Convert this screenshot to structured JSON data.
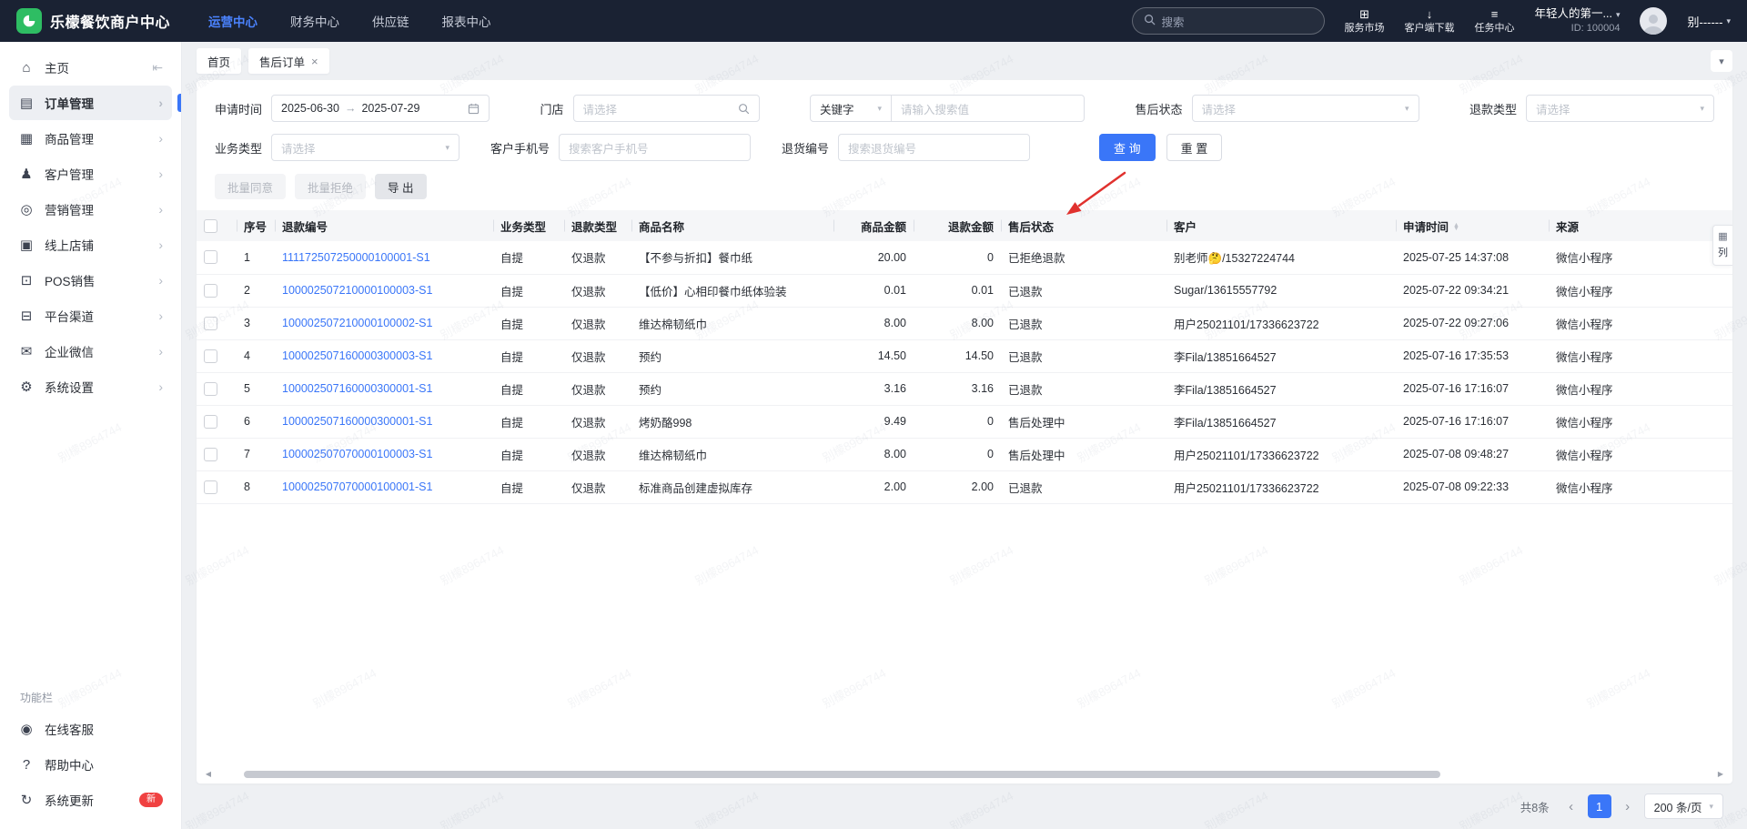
{
  "watermark": "别檬8964744",
  "icons": {
    "caret_down": "▾",
    "chevron_down": "▾",
    "close": "×",
    "prev": "‹",
    "next": "›",
    "sort_asc": "▲",
    "sort_desc": "▼",
    "scroll_left": "◀",
    "scroll_right": "▶",
    "grid": "▦"
  },
  "header": {
    "brand": "乐檬餐饮商户中心",
    "nav": [
      {
        "label": "运营中心",
        "name": "nav-operations-center",
        "active": true
      },
      {
        "label": "财务中心",
        "name": "nav-finance-center"
      },
      {
        "label": "供应链",
        "name": "nav-supply-chain"
      },
      {
        "label": "报表中心",
        "name": "nav-report-center"
      }
    ],
    "search_placeholder": "搜索",
    "quick_links": [
      {
        "label": "服务市场",
        "icon": "service-market-icon",
        "glyph": "⊞"
      },
      {
        "label": "客户端下载",
        "icon": "client-download-icon",
        "glyph": "↓"
      },
      {
        "label": "任务中心",
        "icon": "task-center-icon",
        "glyph": "≡"
      }
    ],
    "user": {
      "name": "年轻人的第一...",
      "id_label": "ID: 100004",
      "account": "别------"
    }
  },
  "sidebar": {
    "items": [
      {
        "label": "主页",
        "name": "sidebar-item-home",
        "icon": "home-icon",
        "glyph": "⌂",
        "arrow": "⇤",
        "arrow_icon": "collapse-sidebar-icon"
      },
      {
        "label": "订单管理",
        "name": "sidebar-item-orders",
        "icon": "order-icon",
        "glyph": "▤",
        "arrow": "›",
        "arrow_icon": "chevron-right-icon",
        "active": true
      },
      {
        "label": "商品管理",
        "name": "sidebar-item-goods",
        "icon": "goods-icon",
        "glyph": "▦",
        "arrow": "›",
        "arrow_icon": "chevron-right-icon"
      },
      {
        "label": "客户管理",
        "name": "sidebar-item-customers",
        "icon": "customer-icon",
        "glyph": "♟",
        "arrow": "›",
        "arrow_icon": "chevron-right-icon"
      },
      {
        "label": "营销管理",
        "name": "sidebar-item-marketing",
        "icon": "marketing-icon",
        "glyph": "◎",
        "arrow": "›",
        "arrow_icon": "chevron-right-icon"
      },
      {
        "label": "线上店铺",
        "name": "sidebar-item-online-store",
        "icon": "store-icon",
        "glyph": "▣",
        "arrow": "›",
        "arrow_icon": "chevron-right-icon"
      },
      {
        "label": "POS销售",
        "name": "sidebar-item-pos-sales",
        "icon": "pos-icon",
        "glyph": "⊡",
        "arrow": "›",
        "arrow_icon": "chevron-right-icon"
      },
      {
        "label": "平台渠道",
        "name": "sidebar-item-channels",
        "icon": "channel-icon",
        "glyph": "⊟",
        "arrow": "›",
        "arrow_icon": "chevron-right-icon"
      },
      {
        "label": "企业微信",
        "name": "sidebar-item-wecom",
        "icon": "wechat-icon",
        "glyph": "✉",
        "arrow": "›",
        "arrow_icon": "chevron-right-icon"
      },
      {
        "label": "系统设置",
        "name": "sidebar-item-settings",
        "icon": "gear-icon",
        "glyph": "⚙",
        "arrow": "›",
        "arrow_icon": "chevron-right-icon"
      }
    ],
    "footer": {
      "title": "功能栏",
      "items": [
        {
          "label": "在线客服",
          "name": "sidebar-item-online-support",
          "icon": "headset-icon",
          "glyph": "◉"
        },
        {
          "label": "帮助中心",
          "name": "sidebar-item-help-center",
          "icon": "help-icon",
          "glyph": "?"
        },
        {
          "label": "系统更新",
          "name": "sidebar-item-system-update",
          "icon": "refresh-icon",
          "glyph": "↻",
          "badge": "新"
        }
      ]
    }
  },
  "tabs": [
    {
      "label": "首页"
    },
    {
      "label": "售后订单",
      "active": true
    }
  ],
  "filters": {
    "apply_time": {
      "label": "申请时间",
      "start": "2025-06-30",
      "separator": "→",
      "end": "2025-07-29"
    },
    "store": {
      "label": "门店",
      "placeholder": "请选择"
    },
    "keyword": {
      "selected": "关键字",
      "placeholder": "请输入搜索值"
    },
    "after_sale_status": {
      "label": "售后状态",
      "placeholder": "请选择"
    },
    "refund_type": {
      "label": "退款类型",
      "placeholder": "请选择"
    },
    "business_type": {
      "label": "业务类型",
      "placeholder": "请选择"
    },
    "customer_phone": {
      "label": "客户手机号",
      "placeholder": "搜索客户手机号"
    },
    "return_no": {
      "label": "退货编号",
      "placeholder": "搜索退货编号"
    },
    "query_label": "查 询",
    "reset_label": "重 置"
  },
  "toolbar": {
    "batch_approve": "批量同意",
    "batch_reject": "批量拒绝",
    "export": "导 出"
  },
  "column_settings_label": "列",
  "table": {
    "columns": [
      "序号",
      "退款编号",
      "业务类型",
      "退款类型",
      "商品名称",
      "商品金额",
      "退款金额",
      "售后状态",
      "客户",
      "申请时间",
      "来源"
    ],
    "rows": [
      {
        "no": 1,
        "refund_no": "111172507250000100001-S1",
        "business_type": "自提",
        "refund_type": "仅退款",
        "product": "【不参与折扣】餐巾纸",
        "amount": "20.00",
        "refund": "0",
        "status": "已拒绝退款",
        "customer": "别老师🤔/15327224744",
        "time": "2025-07-25 14:37:08",
        "source": "微信小程序"
      },
      {
        "no": 2,
        "refund_no": "100002507210000100003-S1",
        "business_type": "自提",
        "refund_type": "仅退款",
        "product": "【低价】心相印餐巾纸体验装",
        "amount": "0.01",
        "refund": "0.01",
        "status": "已退款",
        "customer": "Sugar/13615557792",
        "time": "2025-07-22 09:34:21",
        "source": "微信小程序"
      },
      {
        "no": 3,
        "refund_no": "100002507210000100002-S1",
        "business_type": "自提",
        "refund_type": "仅退款",
        "product": "维达棉韧纸巾",
        "amount": "8.00",
        "refund": "8.00",
        "status": "已退款",
        "customer": "用户25021101/17336623722",
        "time": "2025-07-22 09:27:06",
        "source": "微信小程序"
      },
      {
        "no": 4,
        "refund_no": "100002507160000300003-S1",
        "business_type": "自提",
        "refund_type": "仅退款",
        "product": "预约",
        "amount": "14.50",
        "refund": "14.50",
        "status": "已退款",
        "customer": "李Fila/13851664527",
        "time": "2025-07-16 17:35:53",
        "source": "微信小程序"
      },
      {
        "no": 5,
        "refund_no": "100002507160000300001-S1",
        "business_type": "自提",
        "refund_type": "仅退款",
        "product": "预约",
        "amount": "3.16",
        "refund": "3.16",
        "status": "已退款",
        "customer": "李Fila/13851664527",
        "time": "2025-07-16 17:16:07",
        "source": "微信小程序"
      },
      {
        "no": 6,
        "refund_no": "100002507160000300001-S1",
        "business_type": "自提",
        "refund_type": "仅退款",
        "product": "烤奶酪998",
        "amount": "9.49",
        "refund": "0",
        "status": "售后处理中",
        "customer": "李Fila/13851664527",
        "time": "2025-07-16 17:16:07",
        "source": "微信小程序"
      },
      {
        "no": 7,
        "refund_no": "100002507070000100003-S1",
        "business_type": "自提",
        "refund_type": "仅退款",
        "product": "维达棉韧纸巾",
        "amount": "8.00",
        "refund": "0",
        "status": "售后处理中",
        "customer": "用户25021101/17336623722",
        "time": "2025-07-08 09:48:27",
        "source": "微信小程序"
      },
      {
        "no": 8,
        "refund_no": "100002507070000100001-S1",
        "business_type": "自提",
        "refund_type": "仅退款",
        "product": "标准商品创建虚拟库存",
        "amount": "2.00",
        "refund": "2.00",
        "status": "已退款",
        "customer": "用户25021101/17336623722",
        "time": "2025-07-08 09:22:33",
        "source": "微信小程序"
      }
    ]
  },
  "pagination": {
    "total": "共8条",
    "page": "1",
    "page_size": "200 条/页"
  }
}
